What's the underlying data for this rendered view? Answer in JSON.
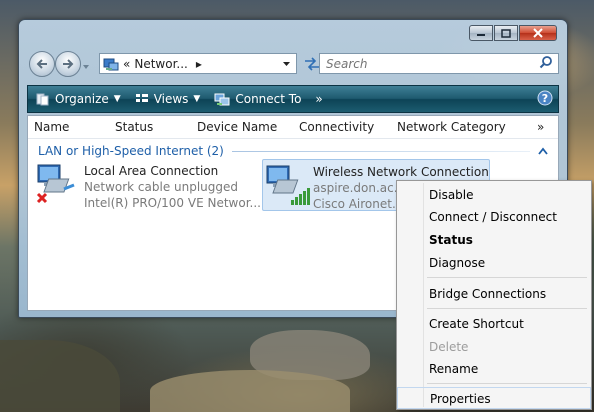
{
  "address": {
    "breadcrumb_prefix": "«",
    "breadcrumb": "Networ...",
    "breadcrumb_arrow": "▸"
  },
  "search": {
    "placeholder": "Search"
  },
  "toolbar": {
    "organize": "Organize",
    "views": "Views",
    "connect_to": "Connect To",
    "more": "»"
  },
  "columns": {
    "name": "Name",
    "status": "Status",
    "device_name": "Device Name",
    "connectivity": "Connectivity",
    "network_category": "Network Category",
    "more": "»"
  },
  "group": {
    "label": "LAN or High-Speed Internet (2)"
  },
  "connections": [
    {
      "name": "Local Area Connection",
      "status": "Network cable unplugged",
      "device": "Intel(R) PRO/100 VE Networ..."
    },
    {
      "name": "Wireless Network Connection",
      "status": "aspire.don.ac...",
      "device": "Cisco Aironet..."
    }
  ],
  "context_menu": [
    {
      "label": "Disable"
    },
    {
      "label": "Connect / Disconnect"
    },
    {
      "label": "Status",
      "default": true
    },
    {
      "label": "Diagnose"
    },
    {
      "label": "Bridge Connections"
    },
    {
      "label": "Create Shortcut"
    },
    {
      "label": "Delete",
      "disabled": true
    },
    {
      "label": "Rename"
    },
    {
      "label": "Properties"
    }
  ],
  "colors": {
    "accent": "#1e5fa8",
    "command_bar": "#1c5c70",
    "selection": "#dbe9f7",
    "close_button": "#cf4b32"
  },
  "icons": {
    "back": "back-arrow-icon",
    "forward": "forward-arrow-icon",
    "refresh": "refresh-icon",
    "search": "search-icon",
    "help": "help-icon"
  }
}
